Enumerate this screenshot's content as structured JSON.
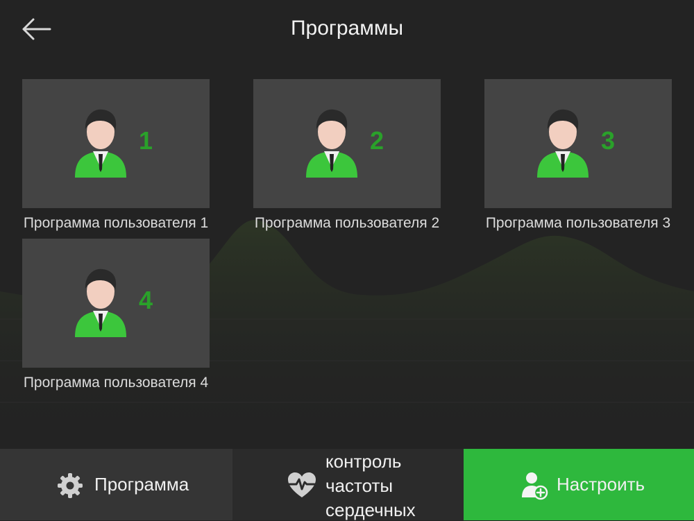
{
  "header": {
    "title": "Программы"
  },
  "programs": [
    {
      "number": "1",
      "label": "Программа пользователя 1"
    },
    {
      "number": "2",
      "label": "Программа пользователя 2"
    },
    {
      "number": "3",
      "label": "Программа пользователя 3"
    },
    {
      "number": "4",
      "label": "Программа пользователя 4"
    }
  ],
  "bottom_bar": {
    "program_label": "Программа",
    "heart_line1": "контроль",
    "heart_line2": "частоты",
    "heart_line3": "сердечных",
    "setup_label": "Настроить"
  },
  "icons": {
    "back": "arrow-left-icon",
    "avatar": "user-avatar-icon",
    "program": "gear-icon",
    "heart": "heart-pulse-icon",
    "setup": "user-add-icon"
  },
  "colors": {
    "background": "#232323",
    "tile": "#444444",
    "accent_green": "#2eb83d",
    "number_green": "#2aa12a"
  }
}
